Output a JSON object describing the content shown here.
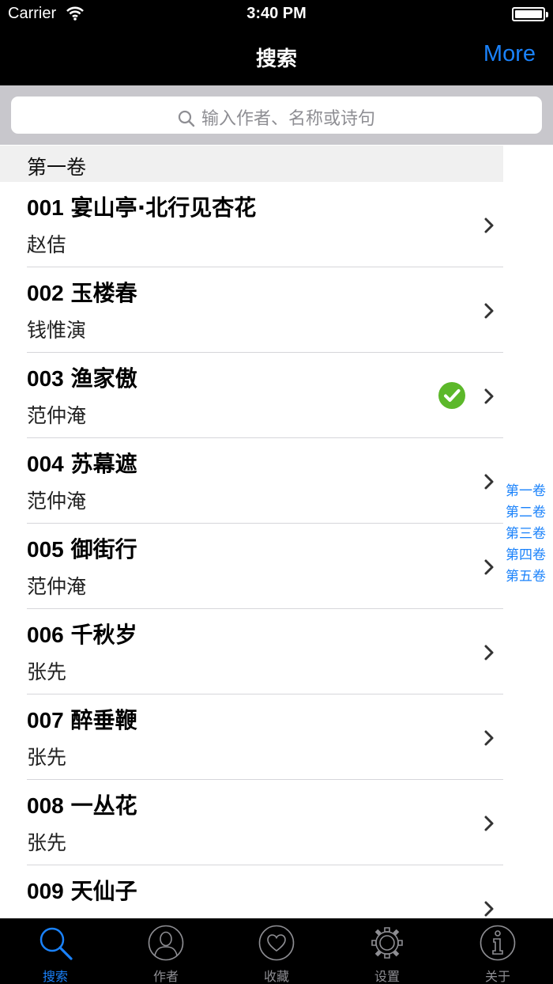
{
  "status_bar": {
    "carrier": "Carrier",
    "time": "3:40 PM"
  },
  "nav": {
    "title": "搜索",
    "more_label": "More"
  },
  "search": {
    "placeholder": "输入作者、名称或诗句"
  },
  "section": {
    "header": "第一卷"
  },
  "poems": [
    {
      "number": "001",
      "title": "宴山亭·北行见杏花",
      "author": "赵佶",
      "favorited": false
    },
    {
      "number": "002",
      "title": "玉楼春",
      "author": "钱惟演",
      "favorited": false
    },
    {
      "number": "003",
      "title": "渔家傲",
      "author": "范仲淹",
      "favorited": true
    },
    {
      "number": "004",
      "title": "苏幕遮",
      "author": "范仲淹",
      "favorited": false
    },
    {
      "number": "005",
      "title": "御街行",
      "author": "范仲淹",
      "favorited": false
    },
    {
      "number": "006",
      "title": "千秋岁",
      "author": "张先",
      "favorited": false
    },
    {
      "number": "007",
      "title": "醉垂鞭",
      "author": "张先",
      "favorited": false
    },
    {
      "number": "008",
      "title": "一丛花",
      "author": "张先",
      "favorited": false
    },
    {
      "number": "009",
      "title": "天仙子",
      "author": "",
      "favorited": false
    }
  ],
  "index": [
    "第一卷",
    "第二卷",
    "第三卷",
    "第四卷",
    "第五卷"
  ],
  "tabs": [
    {
      "label": "搜索",
      "icon": "search-icon",
      "active": true
    },
    {
      "label": "作者",
      "icon": "person-icon",
      "active": false
    },
    {
      "label": "收藏",
      "icon": "heart-icon",
      "active": false
    },
    {
      "label": "设置",
      "icon": "gear-icon",
      "active": false
    },
    {
      "label": "关于",
      "icon": "info-icon",
      "active": false
    }
  ],
  "colors": {
    "accent": "#1a82fb",
    "bar_background": "#000000",
    "check_green": "#5cb82a",
    "search_background": "#c8c7cc"
  }
}
